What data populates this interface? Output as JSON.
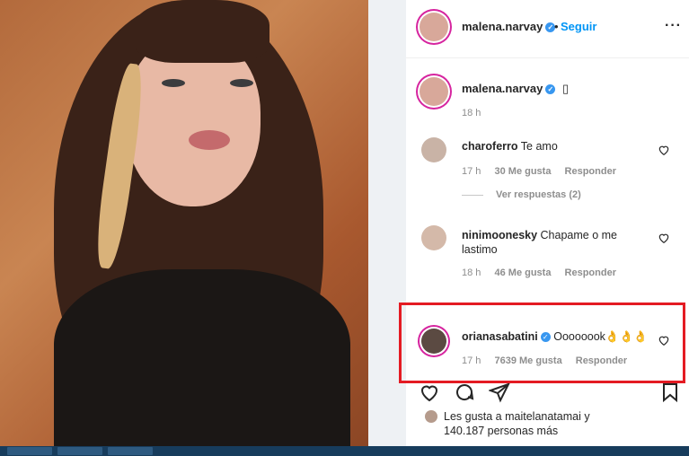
{
  "post": {
    "author": "malena.narvay",
    "follow_label": "Seguir",
    "caption_author": "malena.narvay",
    "caption_glyph": "▯",
    "caption_time": "18 h"
  },
  "comments": [
    {
      "user": "charoferro",
      "text": "Te amo",
      "time": "17 h",
      "likes": "30 Me gusta",
      "reply": "Responder",
      "view_replies": "Ver respuestas (2)"
    },
    {
      "user": "ninimoonesky",
      "text": "Chapame o me",
      "text2": "lastimo",
      "time": "18 h",
      "likes": "46 Me gusta",
      "reply": "Responder"
    },
    {
      "user": "orianasabatini",
      "text": "Oooooook👌👌👌",
      "time": "17 h",
      "likes": "7639 Me gusta",
      "reply": "Responder"
    }
  ],
  "likes_summary": {
    "line1": "Les gusta a maitelanatamai y",
    "line2": "140.187 personas más"
  },
  "colors": {
    "highlight": "#e41b23",
    "verified": "#3897f0",
    "link": "#0095f6"
  }
}
